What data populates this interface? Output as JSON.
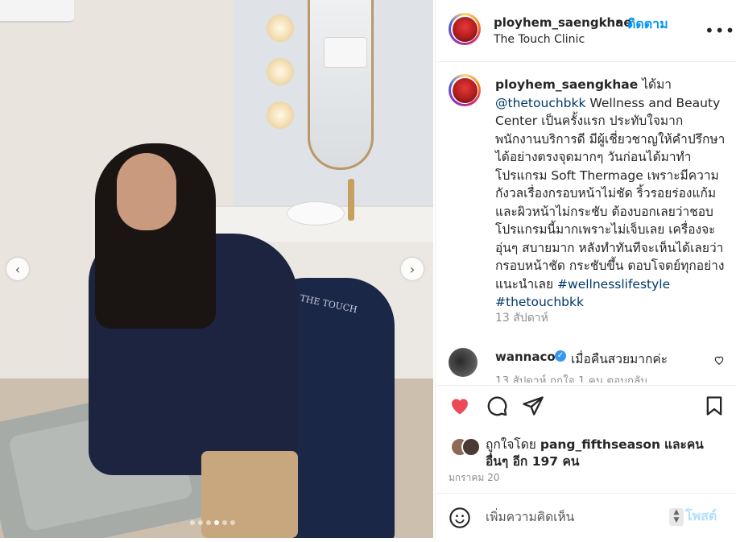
{
  "post": {
    "username": "ployhem_saengkhae",
    "dot": "•",
    "follow_label": "ติดตาม",
    "location": "The Touch Clinic",
    "more_icon": "more-horizontal-icon"
  },
  "caption": {
    "username": "ployhem_saengkhae",
    "text_before_mention": "ได้มา",
    "mention": "@thetouchbkk",
    "body": "Wellness and Beauty Center เป็นครั้งแรก ประทับใจมาก พนักงานบริการดี มีผู้เชี่ยวชาญให้คำปรึกษาได้อย่างตรงจุดมากๆ วันก่อนได้มาทำโปรแกรม Soft Thermage เพราะมีความกังวลเรื่องกรอบหน้าไม่ชัด ริ้วรอยร่องแก้ม และผิวหน้าไม่กระชับ ต้องบอกเลยว่าชอบโปรแกรมนี้มากเพราะไม่เจ็บเลย เครื่องจะอุ่นๆ สบายมาก หลังทำทันทีจะเห็นได้เลยว่ากรอบหน้าชัด กระชับขึ้น ตอบโจตย์ทุกอย่าง แนะนำเลย",
    "hashtags": "#wellnesslifestyle #thetouchbkk",
    "time": "13 สัปดาห์"
  },
  "comment": {
    "username": "wannacoo",
    "text": "เมื่อคืนสวยมากค่ะ",
    "meta": "13 สัปดาห์   ถูกใจ 1 คน   ตอบกลับ"
  },
  "likes": {
    "prefix": "ถูกใจโดย",
    "user": "pang_fifthseason",
    "middle": "และคน",
    "others": "อื่นๆ อีก 197 คน"
  },
  "date": "มกราคม 20",
  "composer": {
    "placeholder": "เพิ่มความคิดเห็น",
    "post_label": "โพสต์"
  },
  "photo": {
    "brand_text": "THE TOUCH",
    "carousel_total": 6,
    "carousel_active": 4
  },
  "colors": {
    "accent": "#0095f6",
    "like": "#ed4956",
    "link": "#00376b",
    "muted": "#8e8e8e"
  }
}
